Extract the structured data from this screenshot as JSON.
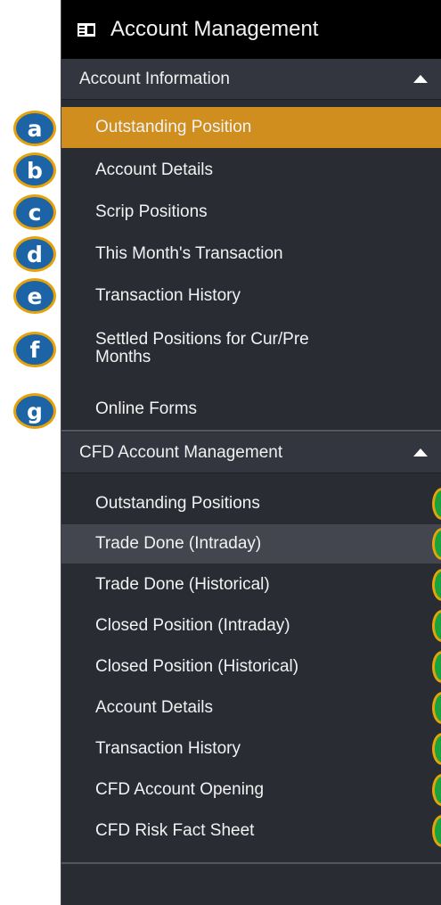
{
  "header": {
    "title": "Account Management",
    "icon": "id-card-icon"
  },
  "section1": {
    "title": "Account Information",
    "items": [
      {
        "label": "Outstanding Position",
        "badge": "a"
      },
      {
        "label": "Account Details",
        "badge": "b"
      },
      {
        "label": "Scrip Positions",
        "badge": "c"
      },
      {
        "label": "This Month's Transaction",
        "badge": "d"
      },
      {
        "label": "Transaction History",
        "badge": "e"
      },
      {
        "label_line1": "Settled Positions for Cur/Pre",
        "label_line2": "Months",
        "badge": "f"
      },
      {
        "label": "Online Forms",
        "badge": "g"
      }
    ]
  },
  "section2": {
    "title": "CFD Account Management",
    "items": [
      {
        "label": "Outstanding Positions"
      },
      {
        "label": "Trade Done (Intraday)"
      },
      {
        "label": "Trade Done (Historical)"
      },
      {
        "label": "Closed Position (Intraday)"
      },
      {
        "label": "Closed Position (Historical)"
      },
      {
        "label": "Account Details"
      },
      {
        "label": "Transaction History"
      },
      {
        "label": "CFD Account Opening"
      },
      {
        "label": "CFD Risk Fact Sheet"
      }
    ]
  },
  "colors": {
    "active_item": "#cf8e1e",
    "panel_bg": "#2a2c34",
    "header_bg": "#000000",
    "badge_blue": "#1c64a6",
    "badge_green": "#1aa33c",
    "badge_border": "#e5a20a"
  }
}
